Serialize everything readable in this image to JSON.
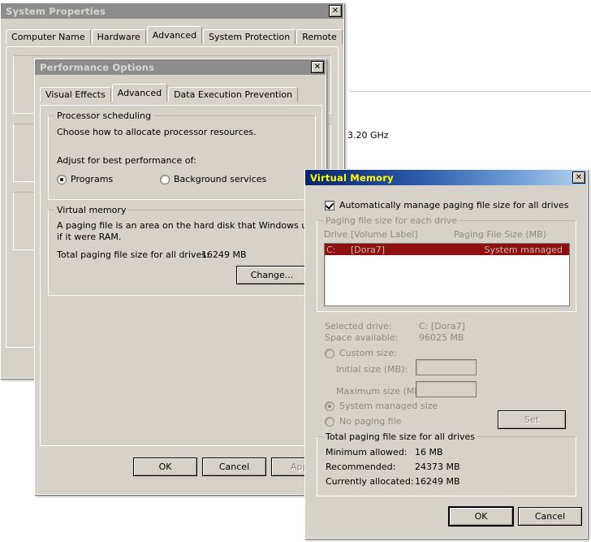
{
  "system_properties": {
    "title": "System Properties",
    "close_label": "✕",
    "tabs": [
      {
        "label": "Computer Name",
        "selected": false
      },
      {
        "label": "Hardware",
        "selected": false
      },
      {
        "label": "Advanced",
        "selected": true
      },
      {
        "label": "System Protection",
        "selected": false
      },
      {
        "label": "Remote",
        "selected": false
      }
    ],
    "visible_content": {
      "processor_speed": "3.20 GHz"
    }
  },
  "performance_options": {
    "title": "Performance Options",
    "close_label": "✕",
    "tabs": [
      {
        "label": "Visual Effects",
        "selected": false
      },
      {
        "label": "Advanced",
        "selected": true
      },
      {
        "label": "Data Execution Prevention",
        "selected": false
      }
    ],
    "processor_scheduling": {
      "legend": "Processor scheduling",
      "description": "Choose how to allocate processor resources.",
      "adjust_label": "Adjust for best performance of:",
      "options": [
        {
          "label": "Programs",
          "checked": true
        },
        {
          "label": "Background services",
          "checked": false
        }
      ]
    },
    "virtual_memory": {
      "legend": "Virtual memory",
      "description_line1": "A paging file is an area on the hard disk that Windows uses as",
      "description_line2": "if it were RAM.",
      "total_label": "Total paging file size for all drives:",
      "total_value": "16249 MB",
      "change_button": "Change..."
    },
    "buttons": {
      "ok": "OK",
      "cancel": "Cancel",
      "apply": "Apply",
      "apply_enabled": false
    }
  },
  "virtual_memory_dialog": {
    "title": "Virtual Memory",
    "close_label": "✕",
    "auto_manage": {
      "label": "Automatically manage paging file size for all drives",
      "checked": true
    },
    "paging_file_group": {
      "legend": "Paging file size for each drive",
      "columns": [
        "Drive  [Volume Label]",
        "Paging File Size (MB)"
      ],
      "rows": [
        {
          "drive": "C:",
          "volume_label": "[Dora7]",
          "size": "System managed",
          "selected": true
        }
      ]
    },
    "selected_drive": {
      "drive_label": "Selected drive:",
      "drive_value": "C:  [Dora7]",
      "space_label": "Space available:",
      "space_value": "96025 MB",
      "custom_size": {
        "label": "Custom size:",
        "checked": false
      },
      "initial_size": {
        "label": "Initial size (MB):",
        "value": ""
      },
      "maximum_size": {
        "label": "Maximum size (MB):",
        "value": ""
      },
      "system_managed": {
        "label": "System managed size",
        "checked": true
      },
      "no_paging_file": {
        "label": "No paging file",
        "checked": false
      },
      "set_button": "Set"
    },
    "totals_group": {
      "legend": "Total paging file size for all drives",
      "rows": [
        {
          "label": "Minimum allowed:",
          "value": "16 MB"
        },
        {
          "label": "Recommended:",
          "value": "24373 MB"
        },
        {
          "label": "Currently allocated:",
          "value": "16249 MB"
        }
      ]
    },
    "buttons": {
      "ok": "OK",
      "cancel": "Cancel"
    }
  }
}
